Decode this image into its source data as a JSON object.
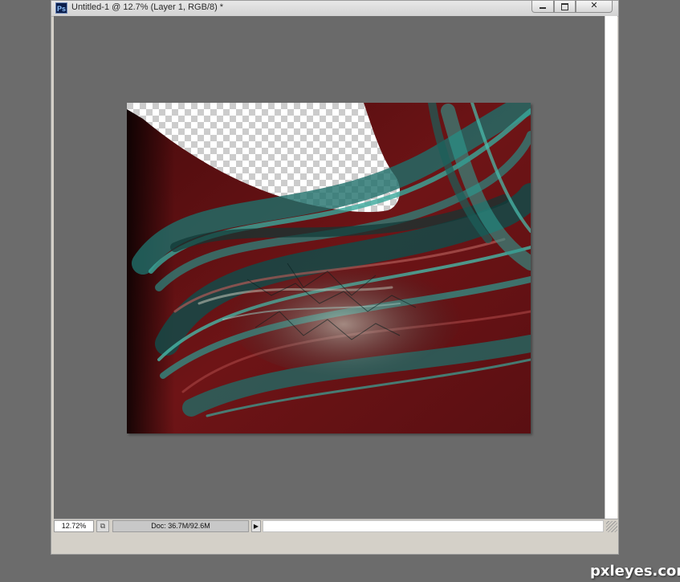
{
  "window": {
    "app_icon": "Ps",
    "title": "Untitled-1 @ 12.7% (Layer 1, RGB/8) *",
    "close_glyph": "✕"
  },
  "status": {
    "zoom": "12.72%",
    "doc_info": "Doc: 36.7M/92.6M",
    "menu_arrow": "▶"
  },
  "icons": {
    "app": "photoshop-icon",
    "status_button": "status-bar-doc-icon"
  },
  "colors": {
    "artwork_red": "#6e1416",
    "artwork_teal": "#2e9b91",
    "canvas_bg": "#6a6a6a"
  },
  "watermark": "pxleyes.com"
}
